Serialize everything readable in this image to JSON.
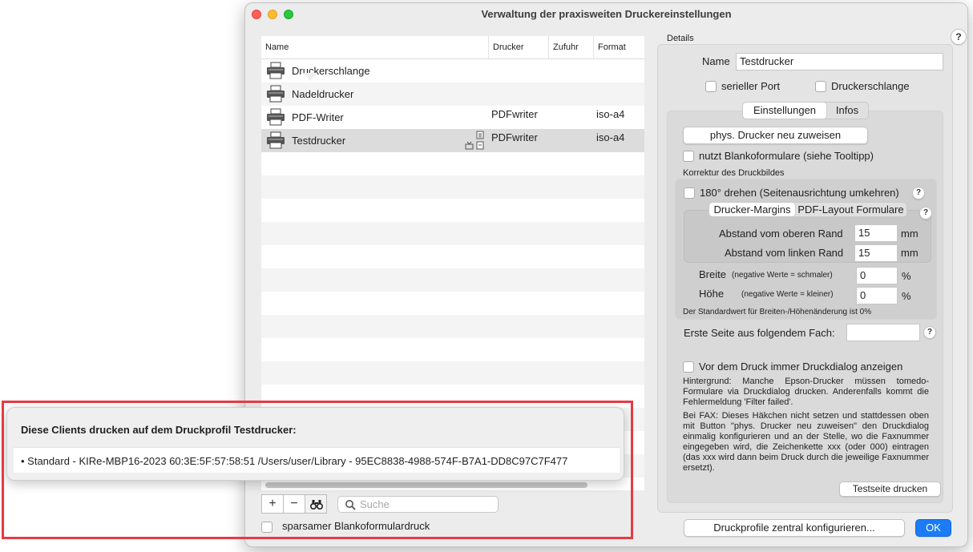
{
  "window": {
    "title": "Verwaltung der praxisweiten Druckereinstellungen"
  },
  "table": {
    "columns": {
      "name": "Name",
      "printer": "Drucker",
      "feed": "Zufuhr",
      "format": "Format"
    },
    "rows": [
      {
        "name": "Druckerschlange",
        "printer": "",
        "feed": "",
        "format": ""
      },
      {
        "name": "Nadeldrucker",
        "printer": "",
        "feed": "",
        "format": ""
      },
      {
        "name": "PDF-Writer",
        "printer": "PDFwriter",
        "feed": "",
        "format": "iso-a4"
      },
      {
        "name": "Testdrucker",
        "printer": "PDFwriter",
        "feed": "",
        "format": "iso-a4"
      }
    ]
  },
  "bottom": {
    "add": "+",
    "remove": "−",
    "search_placeholder": "Suche",
    "economy_label": "sparsamer Blankoformulardruck"
  },
  "details": {
    "section_label": "Details",
    "name_label": "Name",
    "name_value": "Testdrucker",
    "serial_port_label": "serieller Port",
    "queue_label": "Druckerschlange",
    "tabs": {
      "settings": "Einstellungen",
      "info": "Infos"
    },
    "reassign_button": "phys. Drucker neu zuweisen",
    "blank_forms_label": "nutzt Blankoformulare (siehe Tooltipp)",
    "correction_label": "Korrektur des Druckbildes",
    "rotate_label": "180° drehen (Seitenausrichtung umkehren)",
    "subtabs": {
      "margins": "Drucker-Margins",
      "pdf_layout": "PDF-Layout Formulare"
    },
    "top_margin_label": "Abstand vom oberen Rand",
    "top_margin_value": "15",
    "left_margin_label": "Abstand vom linken Rand",
    "left_margin_value": "15",
    "unit_mm": "mm",
    "width_label": "Breite",
    "width_hint": "(negative Werte = schmaler)",
    "width_value": "0",
    "height_label": "Höhe",
    "height_hint": "(negative Werte = kleiner)",
    "height_value": "0",
    "unit_percent": "%",
    "default_note": "Der Standardwert für Breiten-/Höhenänderung ist 0%",
    "first_page_label": "Erste Seite aus folgendem Fach:",
    "first_page_value": "",
    "dialog_label": "Vor dem Druck immer Druckdialog anzeigen",
    "background_text": "Hintergrund: Manche Epson-Drucker müssen tomedo-Formulare via Druckdialog drucken. Anderenfalls kommt die Fehlermeldung 'Filter failed'.",
    "fax_text": "Bei FAX: Dieses Häkchen nicht setzen und stattdessen oben mit Button \"phys. Drucker neu zuweisen\" den Druckdialog einmalig konfigurieren und an der Stelle, wo die Faxnummer eingegeben wird, die Zeichenkette xxx (oder 000) eintragen (das xxx wird dann beim Druck durch die jeweilige Faxnummer ersetzt).",
    "test_page_button": "Testseite drucken"
  },
  "footer": {
    "configure_button": "Druckprofile zentral konfigurieren...",
    "ok_button": "OK"
  },
  "help_symbol": "?",
  "popover": {
    "title": "Diese Clients drucken auf dem Druckprofil Testdrucker:",
    "items": [
      "• Standard - KIRe-MBP16-2023 60:3E:5F:57:58:51 /Users/user/Library - 95EC8838-4988-574F-B7A1-DD8C97C7F477"
    ]
  },
  "colors": {
    "accent": "#1b7cf5",
    "highlight": "#e63a43"
  }
}
